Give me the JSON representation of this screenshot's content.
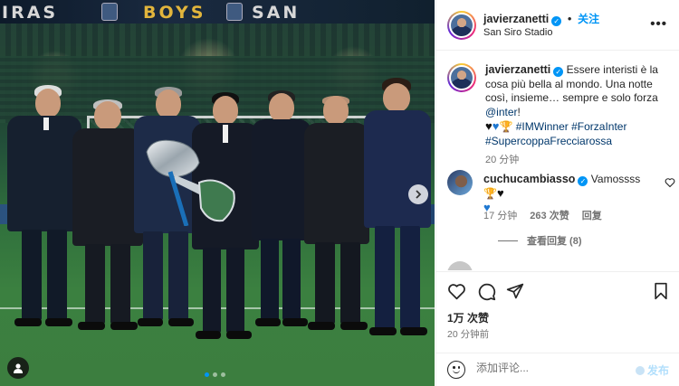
{
  "photo": {
    "banner_left": "IRAS",
    "banner_mid": "BOYS",
    "banner_right": "SAN",
    "next_label": "›",
    "carousel_count": 3,
    "carousel_active": 1
  },
  "post": {
    "author": "javierzanetti",
    "follow_label": "关注",
    "location": "San Siro Stadio",
    "more_label": "•••",
    "caption": {
      "username": "javierzanetti",
      "text_1": "Essere interisti è la cosa più bella al mondo. Una notte così, insieme… sempre e solo forza ",
      "mention": "@inter",
      "text_2": "!",
      "hashtags": [
        "#IMWinner",
        "#ForzaInter",
        "#SupercoppaFrecciarossa"
      ],
      "time": "20 分钟"
    },
    "comment": {
      "username": "cuchucambiasso",
      "text": "Vamossss",
      "time": "17 分钟",
      "likes": "263 次赞",
      "reply_label": "回复",
      "view_replies": "查看回复 (8)"
    },
    "likes": "1万 次赞",
    "posted": "20 分钟前",
    "comment_placeholder": "添加评论...",
    "post_label": "发布"
  },
  "colors": {
    "accent": "#0095f6",
    "link": "#00376b",
    "muted": "#737373"
  }
}
